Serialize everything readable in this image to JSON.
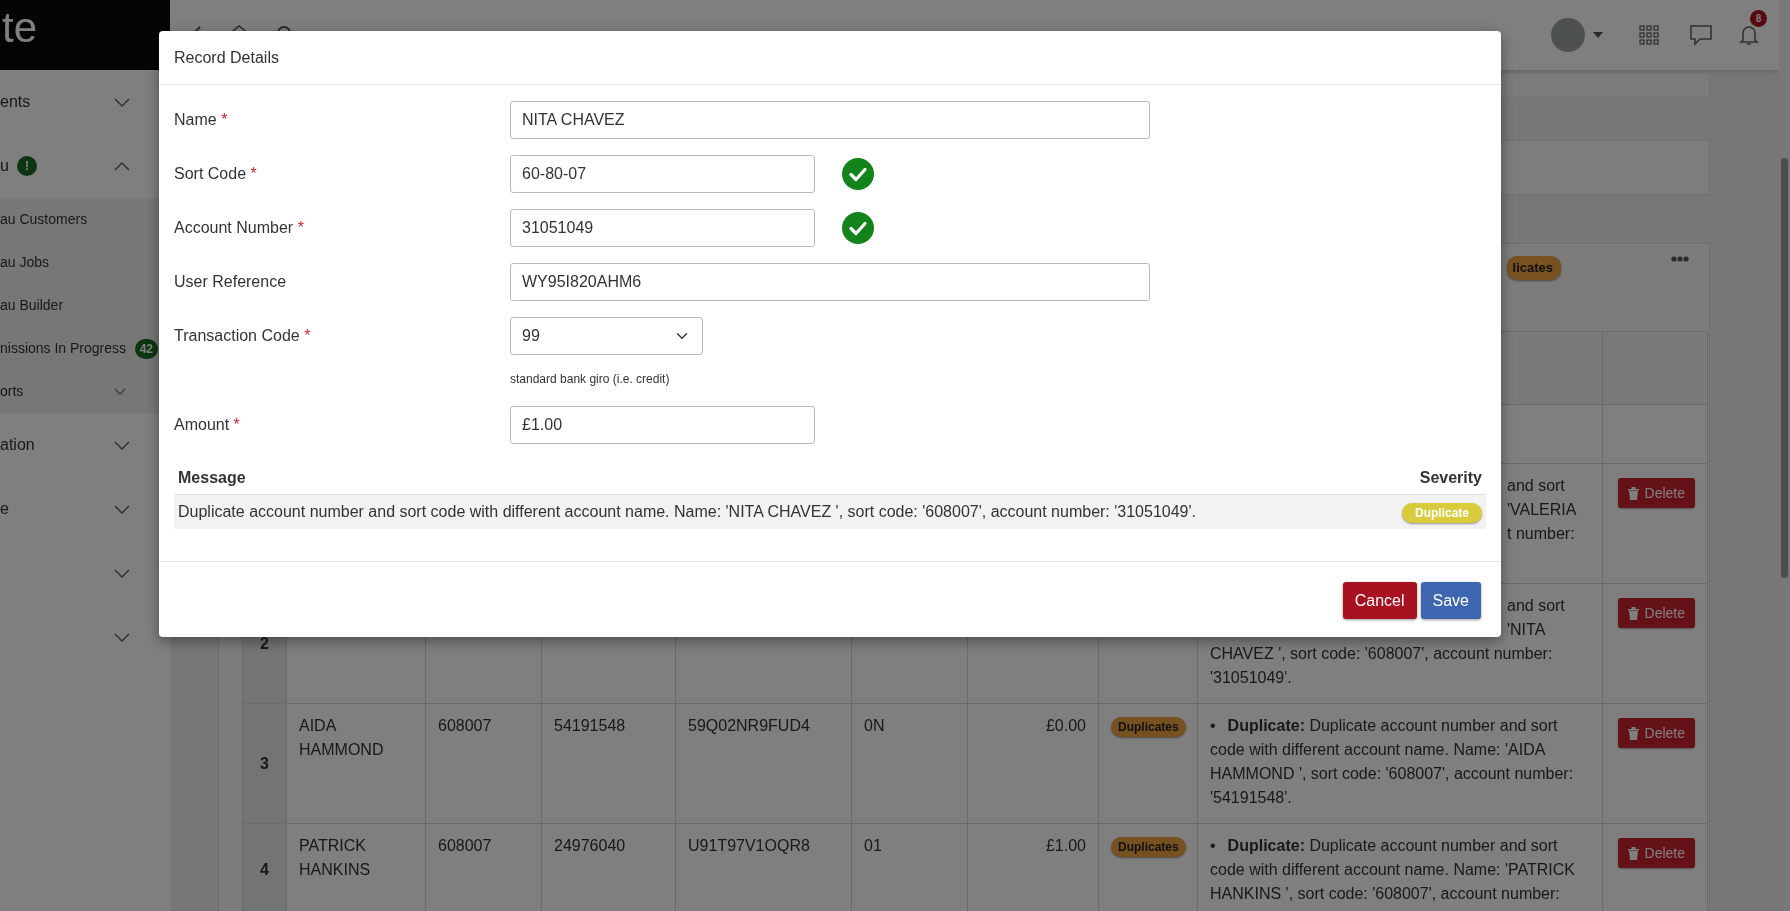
{
  "sidebar": {
    "logo": "te",
    "items": [
      {
        "label": "ents",
        "expanded": false
      },
      {
        "label": "u",
        "badge": "!",
        "expanded": true,
        "children": [
          {
            "label": "au Customers"
          },
          {
            "label": "au Jobs"
          },
          {
            "label": "au Builder"
          },
          {
            "label": "nissions In Progress",
            "badge": "42"
          },
          {
            "label": "orts",
            "expanded": false
          }
        ]
      },
      {
        "label": "ation",
        "expanded": false
      },
      {
        "label": "e",
        "expanded": false
      },
      {
        "expanded": false
      },
      {
        "expanded": false
      }
    ]
  },
  "topbar": {
    "notifications": "8"
  },
  "records_card": {
    "badge": "licates",
    "rows": [
      {
        "message_lines": [
          {
            "text": "and sort",
            "cut": true
          },
          {
            "text": "'VALERIA",
            "cut": true
          },
          {
            "text": "t number:",
            "cut": true
          }
        ],
        "action": "Delete"
      },
      {
        "number": "2",
        "message_lines": [
          {
            "text": "and sort",
            "cut": true
          },
          {
            "text": "'NITA",
            "cut": true
          },
          {
            "text": "CHAVEZ ', sort code: '608007', account number:",
            "cut": false
          },
          {
            "text": "'31051049'.",
            "cut": false
          }
        ],
        "action": "Delete"
      },
      {
        "number": "3",
        "name": "AIDA HAMMOND",
        "sort_code": "608007",
        "account_number": "54191548",
        "reference": "59Q02NR9FUD4",
        "code": "0N",
        "amount": "£0.00",
        "status": "Duplicates",
        "bullet": "•",
        "message": "**Duplicate:** Duplicate account number and sort code with different account name. Name: 'AIDA HAMMOND ', sort code: '608007', account number: '54191548'.",
        "action": "Delete"
      },
      {
        "number": "4",
        "name": "PATRICK HANKINS",
        "sort_code": "608007",
        "account_number": "24976040",
        "reference": "U91T97V1OQR8",
        "code": "01",
        "amount": "£1.00",
        "status": "Duplicates",
        "bullet": "•",
        "message": "**Duplicate:** Duplicate account number and sort code with different account name. Name: 'PATRICK HANKINS ', sort code: '608007', account number:",
        "action": "Delete"
      }
    ]
  },
  "modal": {
    "title": "Record Details",
    "fields": [
      {
        "kind": "text",
        "label": "Name",
        "required_mark": "*",
        "value": "NITA CHAVEZ"
      },
      {
        "kind": "validated",
        "label": "Sort Code",
        "required_mark": "*",
        "value": "60-80-07",
        "valid": true
      },
      {
        "kind": "validated",
        "label": "Account Number",
        "required_mark": "*",
        "value": "31051049",
        "valid": true
      },
      {
        "kind": "text",
        "label": "User Reference",
        "value": "WY95I820AHM6"
      },
      {
        "kind": "select",
        "label": "Transaction Code",
        "required_mark": "*",
        "value": "99",
        "help": "standard bank giro (i.e. credit)"
      },
      {
        "kind": "amount",
        "label": "Amount",
        "required_mark": "*",
        "value": "£1.00"
      }
    ],
    "messages": {
      "columns": [
        "Message",
        "Severity"
      ],
      "rows": [
        {
          "message": "Duplicate account number and sort code with different account name. Name: 'NITA CHAVEZ ', sort code: '608007', account number: '31051049'.",
          "severity": "Duplicate"
        }
      ]
    },
    "buttons": [
      {
        "label": "Cancel",
        "kind": "danger"
      },
      {
        "label": "Save",
        "kind": "primary"
      }
    ]
  }
}
